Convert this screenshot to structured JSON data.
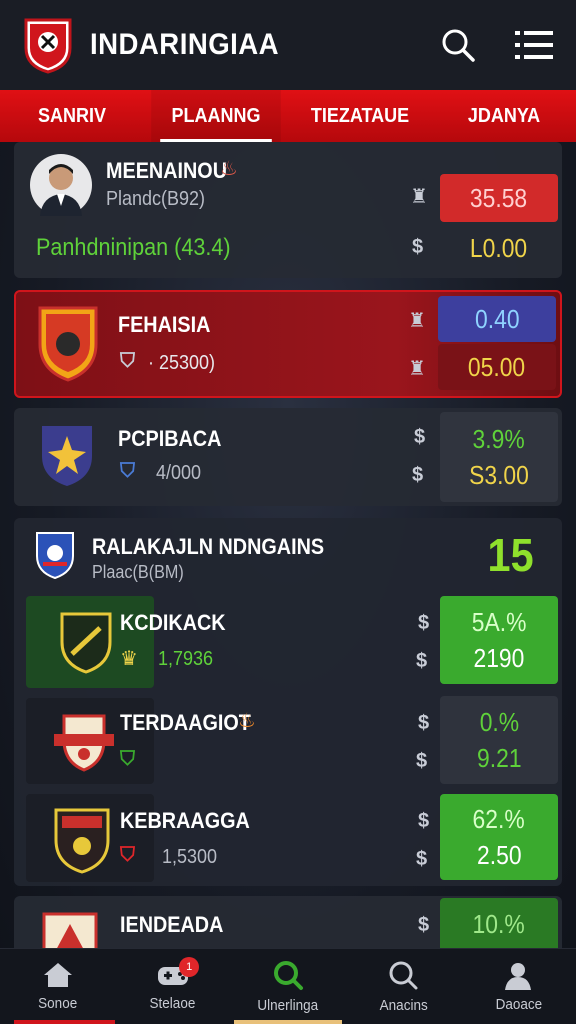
{
  "header": {
    "title": "INDARINGIAA"
  },
  "tabs": [
    {
      "label": "SANRIV"
    },
    {
      "label": "PLAANNG",
      "active": true
    },
    {
      "label": "TIEZATAUE"
    },
    {
      "label": "JDANYA"
    }
  ],
  "player": {
    "name": "MEENAINOU",
    "sub": "Plandc(B92)",
    "stat": "Panhdninipan (43.4)",
    "odds_top": "35.58",
    "odds_bottom": "L0.00"
  },
  "teams": [
    {
      "name": "FEHAISIA",
      "sub": "· 25300)",
      "odds_top": "0.40",
      "odds_bottom": "05.00"
    },
    {
      "name": "PCPIBACA",
      "sub": "4/000",
      "odds_top": "3.9%",
      "odds_bottom": "S3.00"
    }
  ],
  "group": {
    "title": "RALAKAJLN NDNGAINS",
    "sub": "Plaac(B(BM)",
    "score": "15",
    "rows": [
      {
        "name": "KCDIKACK",
        "sub": "1,7936",
        "odds_top": "5A.%",
        "odds_bottom": "2190"
      },
      {
        "name": "TERDAAGIOT",
        "sub": "",
        "odds_top": "0.%",
        "odds_bottom": "9.21"
      },
      {
        "name": "KEBRAAGGA",
        "sub": "1,5300",
        "odds_top": "62.%",
        "odds_bottom": "2.50"
      },
      {
        "name": "IENDEADA",
        "sub": "",
        "odds_top": "10.%",
        "odds_bottom": ""
      }
    ]
  },
  "nav": [
    {
      "label": "Sonoe",
      "icon": "home-icon"
    },
    {
      "label": "Stelaoe",
      "icon": "gamepad-icon",
      "badge": "1"
    },
    {
      "label": "Ulnerlinga",
      "icon": "search-icon",
      "active": true
    },
    {
      "label": "Anacins",
      "icon": "search-icon"
    },
    {
      "label": "Daoace",
      "icon": "profile-icon"
    }
  ],
  "colors": {
    "red": "#d0151c",
    "green": "#39b62e",
    "yellow": "#f0d44a",
    "bg": "#161a24"
  }
}
